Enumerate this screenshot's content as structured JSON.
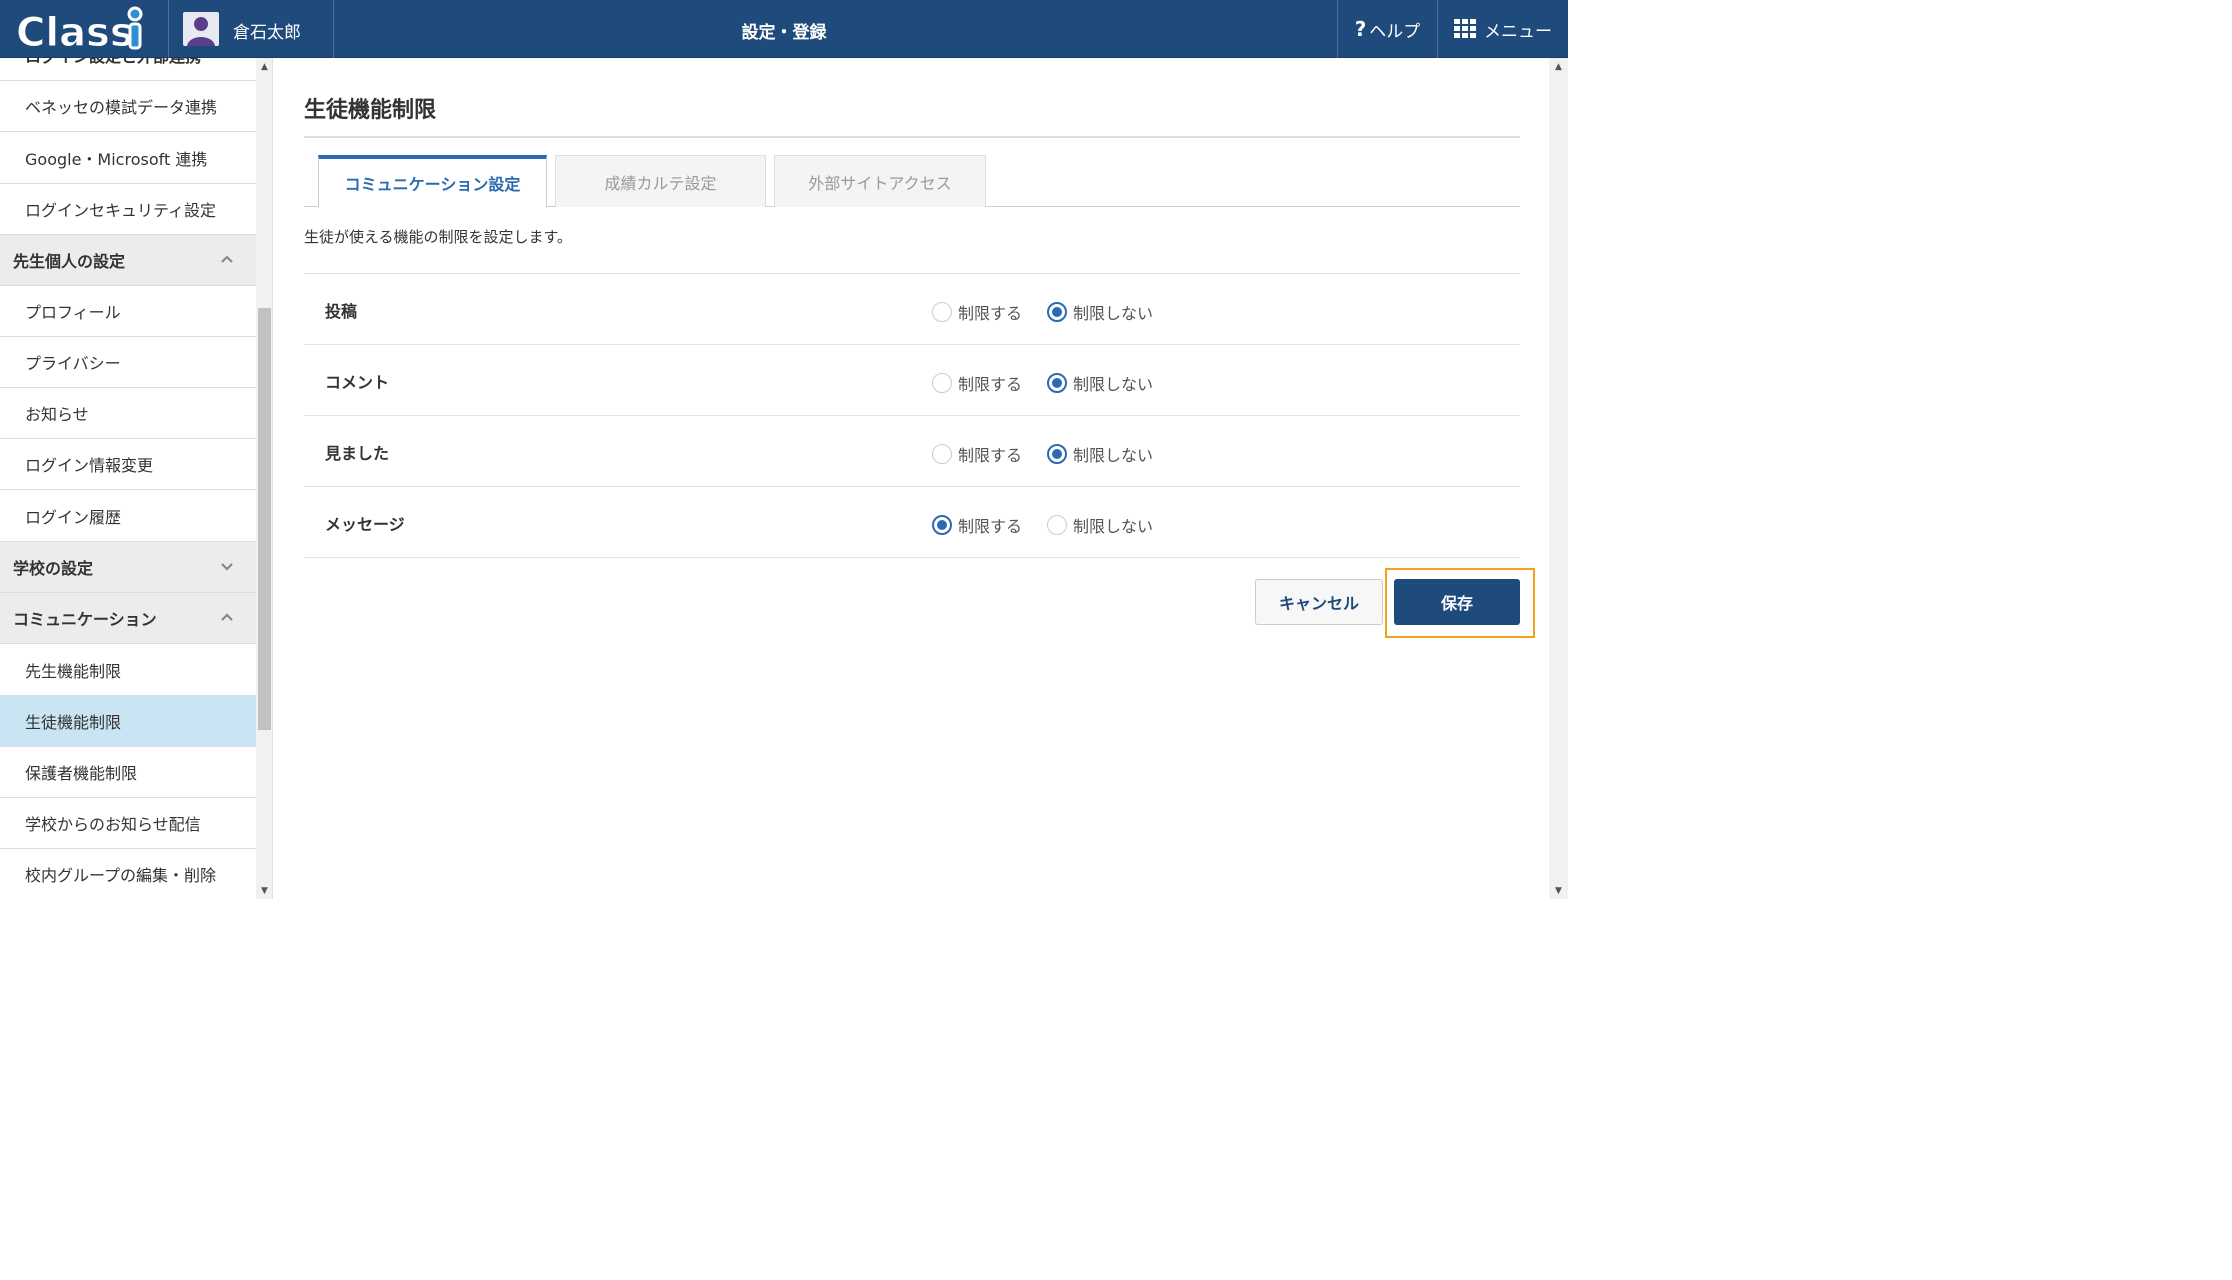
{
  "header": {
    "logo_text": "Classi",
    "user_name": "倉石太郎",
    "title": "設定・登録",
    "help_label": "ヘルプ",
    "menu_label": "メニュー"
  },
  "sidebar": {
    "partial_top_label": "ログイン設定と外部連携",
    "items_group1": [
      "ベネッセの模試データ連携",
      "Google・Microsoft 連携",
      "ログインセキュリティ設定"
    ],
    "section_teacher": "先生個人の設定",
    "items_teacher": [
      "プロフィール",
      "プライバシー",
      "お知らせ",
      "ログイン情報変更",
      "ログイン履歴"
    ],
    "section_school": "学校の設定",
    "section_comm": "コミュニケーション",
    "items_comm": [
      "先生機能制限",
      "生徒機能制限",
      "保護者機能制限",
      "学校からのお知らせ配信",
      "校内グループの編集・削除"
    ],
    "active_item": "生徒機能制限"
  },
  "main": {
    "title": "生徒機能制限",
    "tabs": [
      "コミュニケーション設定",
      "成績カルテ設定",
      "外部サイトアクセス"
    ],
    "active_tab": "コミュニケーション設定",
    "description": "生徒が使える機能の制限を設定します。",
    "option_restrict": "制限する",
    "option_no_restrict": "制限しない",
    "rows": [
      {
        "label": "投稿",
        "value": "制限しない"
      },
      {
        "label": "コメント",
        "value": "制限しない"
      },
      {
        "label": "見ました",
        "value": "制限しない"
      },
      {
        "label": "メッセージ",
        "value": "制限する"
      }
    ],
    "cancel_label": "キャンセル",
    "save_label": "保存"
  },
  "colors": {
    "header_bg": "#1f4a7c",
    "accent": "#2a6ab3",
    "active_sidebar": "#c9e4f2",
    "focus_outline": "#f0a21b"
  }
}
